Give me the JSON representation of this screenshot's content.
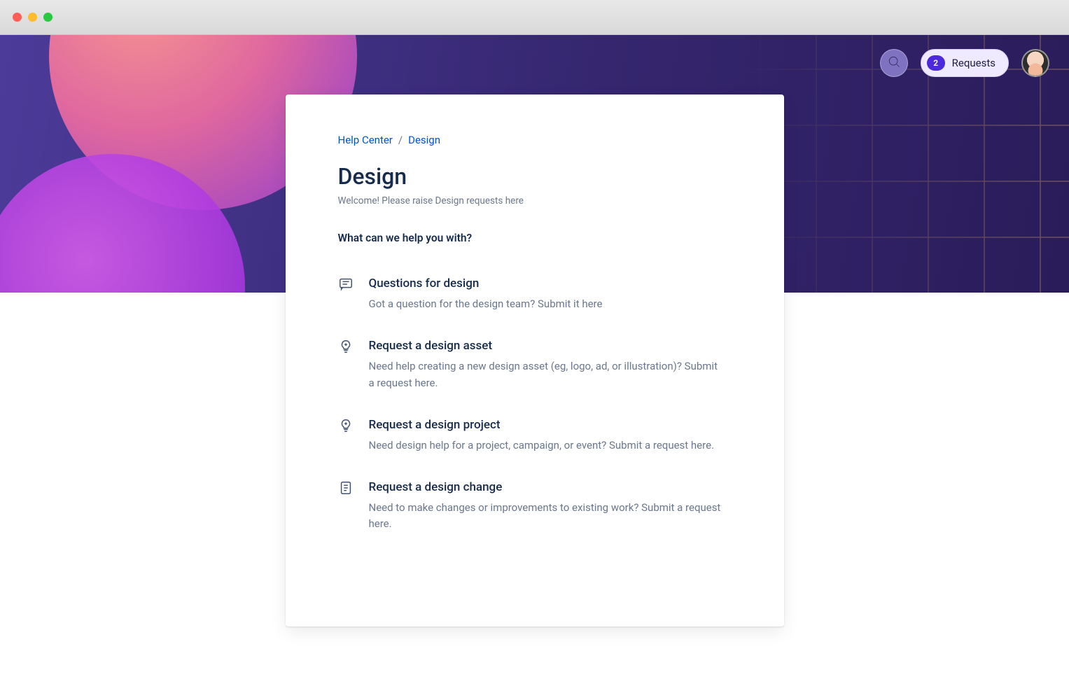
{
  "breadcrumb": {
    "root": "Help Center",
    "current": "Design"
  },
  "page": {
    "title": "Design",
    "subtitle": "Welcome! Please raise Design requests here",
    "prompt": "What can we help you with?"
  },
  "header": {
    "requests_badge": "2",
    "requests_label": "Requests"
  },
  "request_types": [
    {
      "icon": "chat",
      "title": "Questions for design",
      "desc": "Got a question for the design team? Submit it here"
    },
    {
      "icon": "bulb",
      "title": "Request a design asset",
      "desc": "Need help creating a new design asset (eg, logo, ad, or illustration)? Submit a request here."
    },
    {
      "icon": "bulb",
      "title": "Request a design project",
      "desc": "Need design help for a project, campaign, or event? Submit a request here."
    },
    {
      "icon": "doc",
      "title": "Request a design change",
      "desc": "Need to make changes or improvements to existing work? Submit a request here."
    }
  ]
}
